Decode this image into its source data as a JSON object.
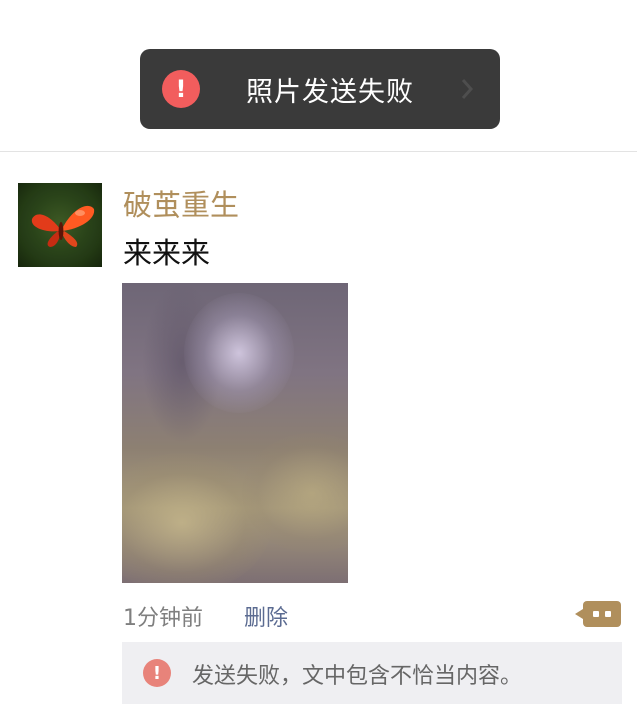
{
  "banner": {
    "text": "照片发送失败",
    "icon": "alert-icon",
    "chevron_icon": "chevron-right-icon"
  },
  "post": {
    "user_name": "破茧重生",
    "text": "来来来",
    "time": "1分钟前",
    "delete_label": "删除",
    "comment_icon": "comment-icon"
  },
  "error": {
    "text": "发送失败，文中包含不恰当内容。",
    "icon": "error-icon"
  },
  "colors": {
    "banner_bg": "#3a3a3a",
    "alert_red": "#f25d5d",
    "name_color": "#b08f5c",
    "link_color": "#5b6b91",
    "error_box_bg": "#efeff2"
  }
}
